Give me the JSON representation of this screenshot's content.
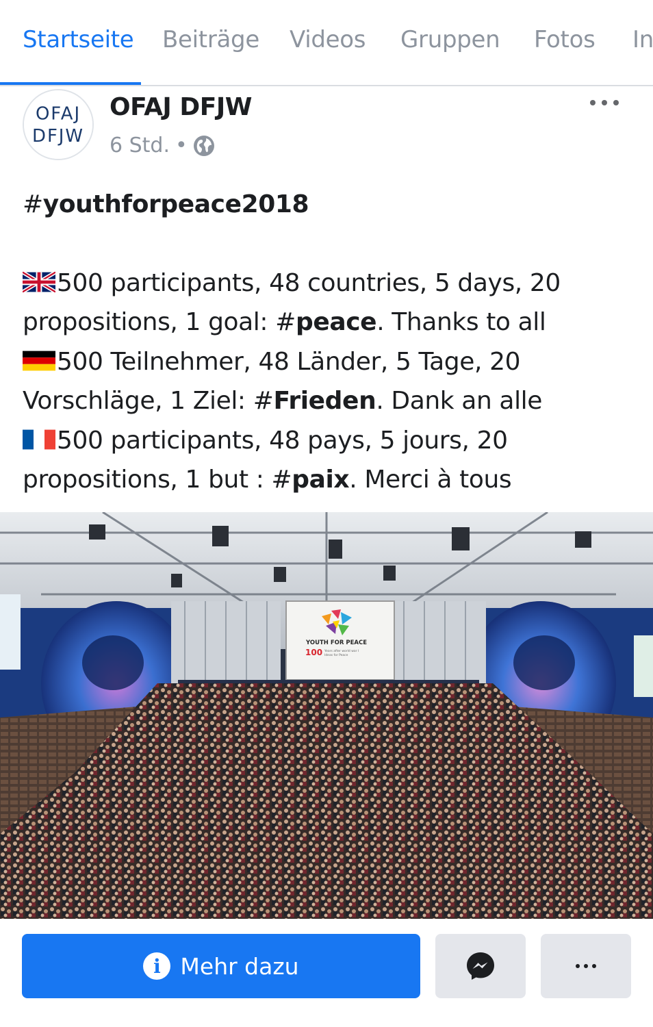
{
  "tabs": [
    {
      "label": "Startseite",
      "active": true
    },
    {
      "label": "Beiträge",
      "active": false
    },
    {
      "label": "Videos",
      "active": false
    },
    {
      "label": "Gruppen",
      "active": false
    },
    {
      "label": "Fotos",
      "active": false
    },
    {
      "label": "In",
      "active": false
    }
  ],
  "post": {
    "page_name": "OFAJ DFJW",
    "avatar_logo_text": [
      "OFAJ",
      "DFJW"
    ],
    "timestamp": "6 Std.",
    "separator": "•",
    "audience_icon": "globe-icon",
    "hashtag_prefix": "#",
    "hashtag": "youthforpeace2018",
    "lines": {
      "en": {
        "flag": "uk-flag-icon",
        "text": "500 participants, 48 countries, 5 days, 20 propositions, 1 goal: #",
        "bold": "peace",
        "rest": ". Thanks to all"
      },
      "de": {
        "flag": "germany-flag-icon",
        "text": "500 Teilnehmer, 48 Länder, 5 Tage, 20 Vorschläge, 1 Ziel: #",
        "bold": "Frieden",
        "rest": ". Dank an alle"
      },
      "fr": {
        "flag": "france-flag-icon",
        "text": "500 participants, 48 pays, 5 jours, 20 propositions, 1 but : #",
        "bold": "paix",
        "rest": ". Merci à tous"
      }
    },
    "photo_screen_text": {
      "title": "YOUTH FOR PEACE",
      "number": "100",
      "subtitle_1": "Years after world war I",
      "subtitle_2": "Ideas for Peace"
    }
  },
  "actions": {
    "more_info_label": "Mehr dazu",
    "info_icon": "i",
    "messenger_icon": "messenger-icon",
    "overflow_icon": "more-dots-icon"
  },
  "colors": {
    "accent": "#1877f2",
    "inactive_tab": "#8d949e",
    "button_gray": "#e4e6eb",
    "text": "#1c1e21"
  }
}
